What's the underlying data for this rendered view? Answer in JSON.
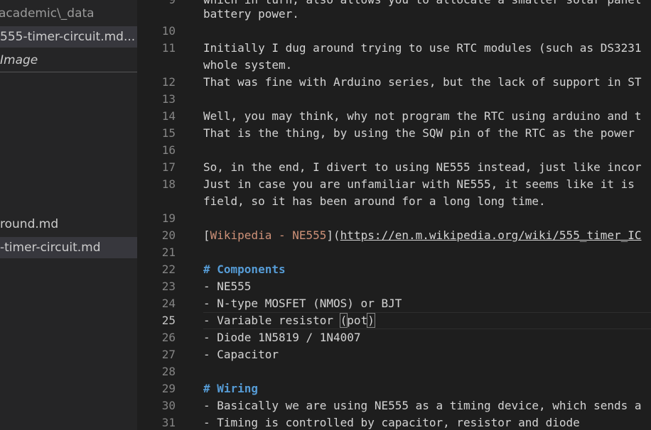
{
  "sidebar": {
    "items": [
      {
        "label": "academic\\_data"
      },
      {
        "label": "555-timer-circuit.md..."
      },
      {
        "label": "Image"
      },
      {
        "label": "round.md"
      },
      {
        "label": "-timer-circuit.md"
      }
    ]
  },
  "editor": {
    "lines": [
      {
        "num": "9",
        "text": "which in turn, also allows you to allocate a smaller solar panel"
      },
      {
        "num": "",
        "text": "battery power."
      },
      {
        "num": "10",
        "text": ""
      },
      {
        "num": "11",
        "text": "Initially I dug around trying to use RTC modules (such as DS3231"
      },
      {
        "num": "",
        "text": "whole system."
      },
      {
        "num": "12",
        "text": "That was fine with Arduino series, but the lack of support in ST"
      },
      {
        "num": "13",
        "text": ""
      },
      {
        "num": "14",
        "text": "Well, you may think, why not program the RTC using arduino and t"
      },
      {
        "num": "15",
        "text": "That is the thing, by using the SQW pin of the RTC as the power"
      },
      {
        "num": "16",
        "text": ""
      },
      {
        "num": "17",
        "text": "So, in the end, I divert to using NE555 instead, just like incor"
      },
      {
        "num": "18",
        "text": "Just in case you are unfamiliar with NE555, it seems like it is"
      },
      {
        "num": "",
        "text": "field, so it has been around for a long long time."
      },
      {
        "num": "19",
        "text": ""
      },
      {
        "num": "20",
        "link_open": "[",
        "link_text": "Wikipedia - NE555",
        "link_mid": "](",
        "link_url": "https://en.m.wikipedia.org/wiki/555_timer_IC"
      },
      {
        "num": "21",
        "text": ""
      },
      {
        "num": "22",
        "heading": "# Components"
      },
      {
        "num": "23",
        "text": "- NE555"
      },
      {
        "num": "24",
        "text": "- N-type MOSFET (NMOS) or BJT"
      },
      {
        "num": "25",
        "pre": "- Variable resistor ",
        "b1": "(",
        "mid": "pot",
        "b2": ")"
      },
      {
        "num": "26",
        "text": "- Diode 1N5819 / 1N4007"
      },
      {
        "num": "27",
        "text": "- Capacitor"
      },
      {
        "num": "28",
        "text": ""
      },
      {
        "num": "29",
        "heading": "# Wiring"
      },
      {
        "num": "30",
        "text": "- Basically we are using NE555 as a timing device, which sends a"
      },
      {
        "num": "31",
        "text": "- Timing is controlled by capacitor, resistor and diode"
      }
    ]
  }
}
